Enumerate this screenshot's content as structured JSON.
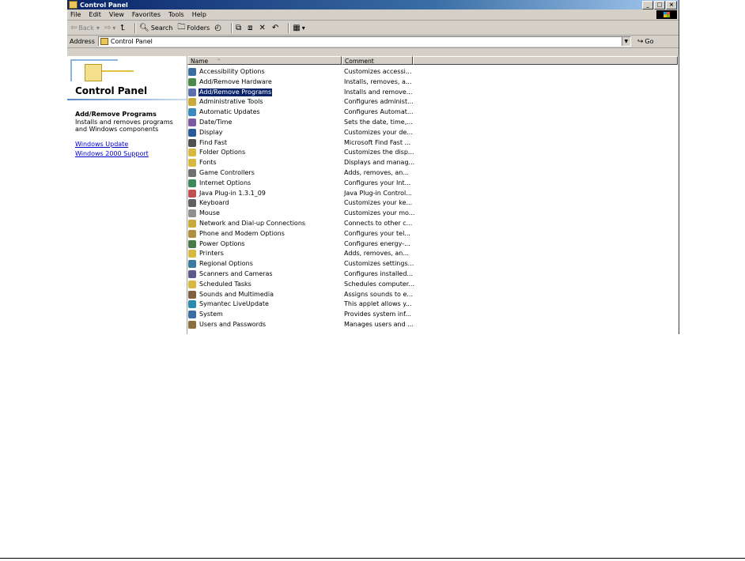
{
  "window": {
    "title": "Control Panel",
    "buttons": [
      "_",
      "□",
      "×"
    ]
  },
  "menu": [
    "File",
    "Edit",
    "View",
    "Favorites",
    "Tools",
    "Help"
  ],
  "toolbar": {
    "back": "Back",
    "search": "Search",
    "folders": "Folders"
  },
  "address": {
    "label": "Address",
    "value": "Control Panel",
    "go": "Go"
  },
  "left_panel": {
    "title": "Control Panel",
    "selected_title": "Add/Remove Programs",
    "selected_desc": "Installs and removes programs and Windows components",
    "links": [
      "Windows Update",
      "Windows 2000 Support"
    ]
  },
  "columns": {
    "name": "Name",
    "comment": "Comment"
  },
  "items": [
    {
      "name": "Accessibility Options",
      "comment": "Customizes accessi...",
      "color": "#3a6ea5"
    },
    {
      "name": "Add/Remove Hardware",
      "comment": "Installs, removes, a...",
      "color": "#4a8a4a"
    },
    {
      "name": "Add/Remove Programs",
      "comment": "Installs and remove...",
      "color": "#5a6fb0",
      "selected": true
    },
    {
      "name": "Administrative Tools",
      "comment": "Configures administ...",
      "color": "#c9a93a"
    },
    {
      "name": "Automatic Updates",
      "comment": "Configures Automat...",
      "color": "#3a8ac0"
    },
    {
      "name": "Date/Time",
      "comment": "Sets the date, time,...",
      "color": "#7a5aa0"
    },
    {
      "name": "Display",
      "comment": "Customizes your de...",
      "color": "#2a5a9a"
    },
    {
      "name": "Find Fast",
      "comment": "Microsoft Find Fast ...",
      "color": "#505050"
    },
    {
      "name": "Folder Options",
      "comment": "Customizes the disp...",
      "color": "#d8b840"
    },
    {
      "name": "Fonts",
      "comment": "Displays and manag...",
      "color": "#d8b840"
    },
    {
      "name": "Game Controllers",
      "comment": "Adds, removes, an...",
      "color": "#707070"
    },
    {
      "name": "Internet Options",
      "comment": "Configures your Int...",
      "color": "#3a8a5a"
    },
    {
      "name": "Java Plug-in 1.3.1_09",
      "comment": "Java Plug-in Control...",
      "color": "#c05050"
    },
    {
      "name": "Keyboard",
      "comment": "Customizes your ke...",
      "color": "#606060"
    },
    {
      "name": "Mouse",
      "comment": "Customizes your mo...",
      "color": "#909090"
    },
    {
      "name": "Network and Dial-up Connections",
      "comment": "Connects to other c...",
      "color": "#c9a93a"
    },
    {
      "name": "Phone and Modem Options",
      "comment": "Configures your tel...",
      "color": "#b09040"
    },
    {
      "name": "Power Options",
      "comment": "Configures energy-...",
      "color": "#4a7a4a"
    },
    {
      "name": "Printers",
      "comment": "Adds, removes, an...",
      "color": "#d8b840"
    },
    {
      "name": "Regional Options",
      "comment": "Customizes settings...",
      "color": "#3a7aa0"
    },
    {
      "name": "Scanners and Cameras",
      "comment": "Configures installed...",
      "color": "#5a5a8a"
    },
    {
      "name": "Scheduled Tasks",
      "comment": "Schedules computer...",
      "color": "#d8b840"
    },
    {
      "name": "Sounds and Multimedia",
      "comment": "Assigns sounds to e...",
      "color": "#806040"
    },
    {
      "name": "Symantec LiveUpdate",
      "comment": "This applet allows y...",
      "color": "#2a8ab0"
    },
    {
      "name": "System",
      "comment": "Provides system inf...",
      "color": "#3a6ea5"
    },
    {
      "name": "Users and Passwords",
      "comment": "Manages users and ...",
      "color": "#8a7040"
    }
  ]
}
